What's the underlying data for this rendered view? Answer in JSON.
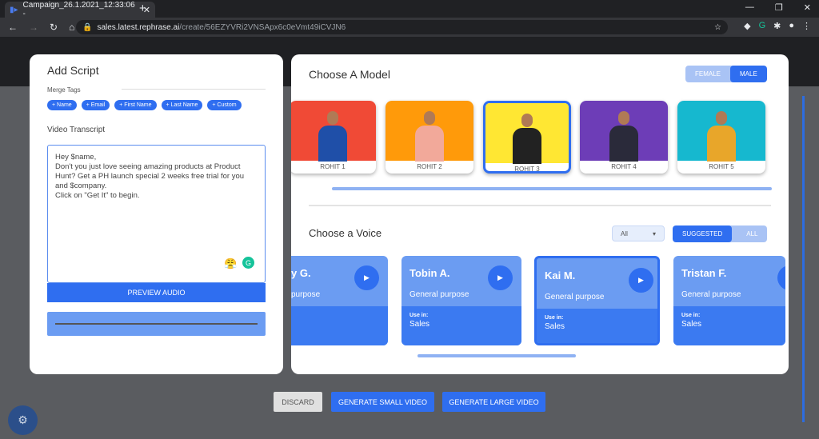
{
  "browser": {
    "tab_title": "Campaign_26.1.2021_12:33:06 - ",
    "url_host": "sales.latest.rephrase.ai",
    "url_path": "/create/56EZYVRi2VNSApx6c0eVmt49iCVJN6"
  },
  "script": {
    "title": "Add Script",
    "merge_tags_label": "Merge Tags",
    "tags": [
      "+ Name",
      "+ Email",
      "+ First Name",
      "+ Last Name",
      "+ Custom"
    ],
    "transcript_label": "Video Transcript",
    "transcript": "Hey $name,\nDon't you just love seeing amazing products at Product Hunt? Get a PH launch special 2 weeks free trial for you and $company.\nClick on \"Get It\" to begin.",
    "preview_audio": "PREVIEW AUDIO"
  },
  "model": {
    "title": "Choose A Model",
    "gender": [
      "FEMALE",
      "MALE"
    ],
    "selected_gender": "MALE",
    "models": [
      {
        "name": "ROHIT 1",
        "bg": "#f04a36",
        "shirt": "#1f4fa8"
      },
      {
        "name": "ROHIT 2",
        "bg": "#ff9a0a",
        "shirt": "#f2a99a"
      },
      {
        "name": "ROHIT 3",
        "bg": "#ffe733",
        "shirt": "#222222"
      },
      {
        "name": "ROHIT 4",
        "bg": "#6d3db7",
        "shirt": "#2a2a3a"
      },
      {
        "name": "ROHIT 5",
        "bg": "#16b8cf",
        "shirt": "#e8a62a"
      }
    ],
    "selected": "ROHIT 3"
  },
  "voice": {
    "title": "Choose a Voice",
    "filter": "All",
    "toggle": [
      "SUGGESTED",
      "ALL"
    ],
    "voices": [
      {
        "name": "y G.",
        "desc": "purpose",
        "use_label": "",
        "use": ""
      },
      {
        "name": "Tobin A.",
        "desc": "General purpose",
        "use_label": "Use in:",
        "use": "Sales"
      },
      {
        "name": "Kai M.",
        "desc": "General purpose",
        "use_label": "Use in:",
        "use": "Sales"
      },
      {
        "name": "Tristan F.",
        "desc": "General purpose",
        "use_label": "Use in:",
        "use": "Sales"
      }
    ],
    "selected": "Kai M."
  },
  "actions": {
    "discard": "DISCARD",
    "small": "GENERATE SMALL VIDEO",
    "large": "GENERATE LARGE VIDEO"
  }
}
